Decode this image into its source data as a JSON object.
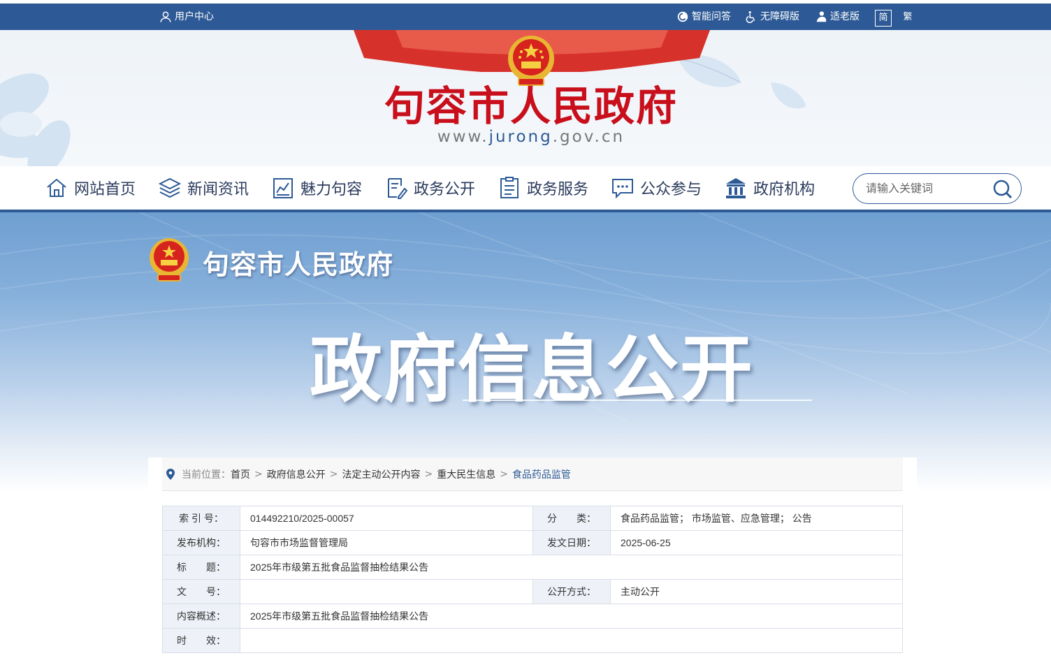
{
  "topbar": {
    "user_center": "用户中心",
    "qa": "智能问答",
    "accessibility": "无障碍版",
    "elder": "适老版",
    "simplified": "简",
    "traditional": "繁"
  },
  "header": {
    "title": "句容市人民政府",
    "url_prefix": "www.",
    "url_mid": "jurong",
    "url_suffix": ".gov.cn"
  },
  "nav": {
    "items": [
      {
        "label": "网站首页",
        "icon": "home-icon"
      },
      {
        "label": "新闻资讯",
        "icon": "layers-icon"
      },
      {
        "label": "魅力句容",
        "icon": "chart-doc-icon"
      },
      {
        "label": "政务公开",
        "icon": "edit-doc-icon"
      },
      {
        "label": "政务服务",
        "icon": "list-doc-icon"
      },
      {
        "label": "公众参与",
        "icon": "chat-icon"
      },
      {
        "label": "政府机构",
        "icon": "building-icon"
      }
    ],
    "search_placeholder": "请输入关键词"
  },
  "banner": {
    "site_name": "句容市人民政府",
    "title": "政府信息公开"
  },
  "breadcrumb": {
    "label": "当前位置：",
    "items": [
      "首页",
      "政府信息公开",
      "法定主动公开内容",
      "重大民生信息"
    ],
    "current": "食品药品监管",
    "separator": ">"
  },
  "info": {
    "index_label": "索 引 号：",
    "index_value": "014492210/2025-00057",
    "category_label": "分　　类：",
    "category_value": "食品药品监管； 市场监管、应急管理； 公告",
    "publisher_label": "发布机构：",
    "publisher_value": "句容市市场监督管理局",
    "date_label": "发文日期：",
    "date_value": "2025-06-25",
    "title_label": "标　　题：",
    "title_value": "2025年市级第五批食品监督抽检结果公告",
    "doc_no_label": "文　　号：",
    "doc_no_value": "",
    "open_mode_label": "公开方式：",
    "open_mode_value": "主动公开",
    "summary_label": "内容概述：",
    "summary_value": "2025年市级第五批食品监督抽检结果公告",
    "validity_label": "时　　效：",
    "validity_value": ""
  },
  "colors": {
    "brand_blue": "#2d5a96",
    "title_red": "#c80f1b"
  }
}
